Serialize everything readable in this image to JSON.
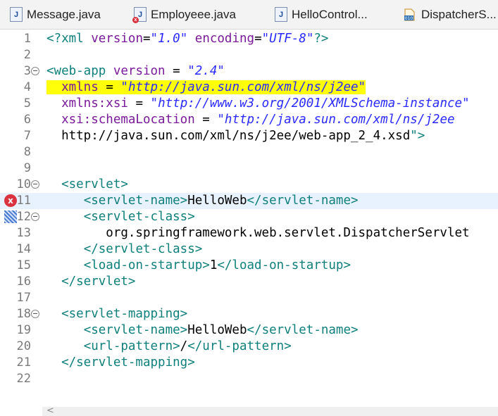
{
  "tabs": [
    {
      "label": "Message.java",
      "icon": "java-file-icon"
    },
    {
      "label": "Employeee.java",
      "icon": "java-file-error-icon"
    },
    {
      "label": "HelloControl...",
      "icon": "java-file-icon"
    },
    {
      "label": "DispatcherS...",
      "icon": "class-file-icon"
    }
  ],
  "lines": [
    {
      "n": "1",
      "text": "<?xml version=\"1.0\" encoding=\"UTF-8\"?>"
    },
    {
      "n": "2",
      "text": ""
    },
    {
      "n": "3",
      "text": "<web-app version = \"2.4\""
    },
    {
      "n": "4",
      "text": "  xmlns = \"http://java.sun.com/xml/ns/j2ee\""
    },
    {
      "n": "5",
      "text": "  xmlns:xsi = \"http://www.w3.org/2001/XMLSchema-instance\""
    },
    {
      "n": "6",
      "text": "  xsi:schemaLocation = \"http://java.sun.com/xml/ns/j2ee"
    },
    {
      "n": "7",
      "text": "  http://java.sun.com/xml/ns/j2ee/web-app_2_4.xsd\">"
    },
    {
      "n": "8",
      "text": ""
    },
    {
      "n": "9",
      "text": ""
    },
    {
      "n": "10",
      "text": "  <servlet>"
    },
    {
      "n": "11",
      "text": "     <servlet-name>HelloWeb</servlet-name>"
    },
    {
      "n": "12",
      "text": "     <servlet-class>"
    },
    {
      "n": "13",
      "text": "        org.springframework.web.servlet.DispatcherServlet"
    },
    {
      "n": "14",
      "text": "     </servlet-class>"
    },
    {
      "n": "15",
      "text": "     <load-on-startup>1</load-on-startup>"
    },
    {
      "n": "16",
      "text": "  </servlet>"
    },
    {
      "n": "17",
      "text": ""
    },
    {
      "n": "18",
      "text": "  <servlet-mapping>"
    },
    {
      "n": "19",
      "text": "     <servlet-name>HelloWeb</servlet-name>"
    },
    {
      "n": "20",
      "text": "     <url-pattern>/</url-pattern>"
    },
    {
      "n": "21",
      "text": "  </servlet-mapping>"
    },
    {
      "n": "22",
      "text": ""
    }
  ],
  "scroll_arrow": "<",
  "colors": {
    "tag": "#0e7f7a",
    "attr": "#7a1a9a",
    "value": "#2a2aff",
    "highlight": "#ffff0a",
    "error": "#d9333f"
  }
}
